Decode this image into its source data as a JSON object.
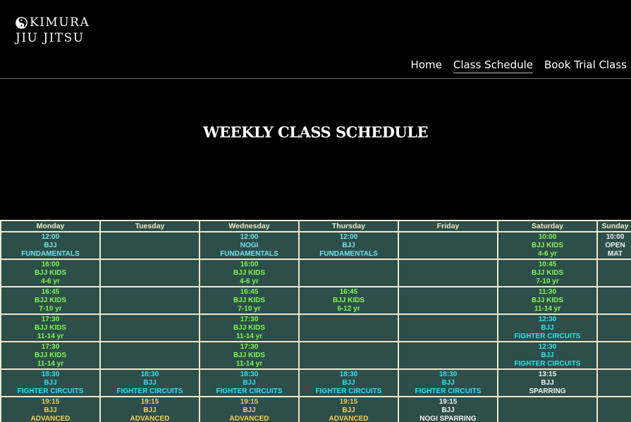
{
  "brand": {
    "line1": "KIMURA",
    "line2": "JIU JITSU"
  },
  "nav": [
    {
      "label": "Home",
      "active": false
    },
    {
      "label": "Class Schedule",
      "active": true
    },
    {
      "label": "Book Trial Class",
      "active": false
    }
  ],
  "page": {
    "title": "WEEKLY CLASS SCHEDULE"
  },
  "schedule": {
    "days": [
      "Monday",
      "Tuesday",
      "Wednesday",
      "Thursday",
      "Friday",
      "Saturday",
      "Sunday"
    ],
    "colors": {
      "fund": "#6ee6ee",
      "kids": "#7dfa52",
      "fc": "#2fe1f2",
      "adv": "#f3d14f",
      "spar": "#f2f2f2"
    },
    "rows": [
      [
        {
          "time": "12:00",
          "name": "BJJ",
          "detail": "FUNDAMENTALS",
          "kind": "fund"
        },
        null,
        {
          "time": "12:00",
          "name": "NOGI",
          "detail": "FUNDAMENTALS",
          "kind": "fund"
        },
        {
          "time": "12:00",
          "name": "BJJ",
          "detail": "FUNDAMENTALS",
          "kind": "fund"
        },
        null,
        {
          "time": "10:00",
          "name": "BJJ KIDS",
          "detail": "4-6 yr",
          "kind": "kids"
        },
        {
          "time": "10:00",
          "name": "OPEN",
          "detail": "MAT",
          "kind": "spar"
        }
      ],
      [
        {
          "time": "16:00",
          "name": "BJJ KIDS",
          "detail": "4-6 yr",
          "kind": "kids"
        },
        null,
        {
          "time": "16:00",
          "name": "BJJ KIDS",
          "detail": "4-6 yr",
          "kind": "kids"
        },
        null,
        null,
        {
          "time": "10:45",
          "name": "BJJ KIDS",
          "detail": "7-10 yr",
          "kind": "kids"
        },
        null
      ],
      [
        {
          "time": "16:45",
          "name": "BJJ KIDS",
          "detail": "7-10 yr",
          "kind": "kids"
        },
        null,
        {
          "time": "16:45",
          "name": "BJJ KIDS",
          "detail": "7-10 yr",
          "kind": "kids"
        },
        {
          "time": "16:45",
          "name": "BJJ KIDS",
          "detail": "6-12 yr",
          "kind": "kids"
        },
        null,
        {
          "time": "11:30",
          "name": "BJJ KIDS",
          "detail": "11-14 yr",
          "kind": "kids"
        },
        null
      ],
      [
        {
          "time": "17:30",
          "name": "BJJ KIDS",
          "detail": "11-14 yr",
          "kind": "kids"
        },
        null,
        {
          "time": "17:30",
          "name": "BJJ KIDS",
          "detail": "11-14 yr",
          "kind": "kids"
        },
        null,
        null,
        {
          "time": "12:30",
          "name": "BJJ",
          "detail": "FIGHTER CIRCUITS",
          "kind": "fc"
        },
        null
      ],
      [
        {
          "time": "17:30",
          "name": "BJJ KIDS",
          "detail": "11-14 yr",
          "kind": "kids"
        },
        null,
        {
          "time": "17:30",
          "name": "BJJ KIDS",
          "detail": "11-14 yr",
          "kind": "kids"
        },
        null,
        null,
        {
          "time": "12:30",
          "name": "BJJ",
          "detail": "FIGHTER CIRCUITS",
          "kind": "fc"
        },
        null
      ],
      [
        {
          "time": "18:30",
          "name": "BJJ",
          "detail": "FIGHTER CIRCUITS",
          "kind": "fc"
        },
        {
          "time": "18:30",
          "name": "BJJ",
          "detail": "FIGHTER CIRCUITS",
          "kind": "fc"
        },
        {
          "time": "18:30",
          "name": "BJJ",
          "detail": "FIGHTER CIRCUITS",
          "kind": "fc"
        },
        {
          "time": "18:30",
          "name": "BJJ",
          "detail": "FIGHTER CIRCUITS",
          "kind": "fc"
        },
        {
          "time": "18:30",
          "name": "BJJ",
          "detail": "FIGHTER CIRCUITS",
          "kind": "fc"
        },
        {
          "time": "13:15",
          "name": "BJJ",
          "detail": "SPARRING",
          "kind": "spar"
        },
        null
      ],
      [
        {
          "time": "19:15",
          "name": "BJJ",
          "detail": "ADVANCED",
          "kind": "adv"
        },
        {
          "time": "19:15",
          "name": "BJJ",
          "detail": "ADVANCED",
          "kind": "adv"
        },
        {
          "time": "19:15",
          "name": "BJJ",
          "detail": "ADVANCED",
          "kind": "adv"
        },
        {
          "time": "19:15",
          "name": "BJJ",
          "detail": "ADVANCED",
          "kind": "adv"
        },
        {
          "time": "19:15",
          "name": "BJJ",
          "detail": "NOGI SPARRING",
          "kind": "spar"
        },
        null,
        null
      ]
    ]
  }
}
